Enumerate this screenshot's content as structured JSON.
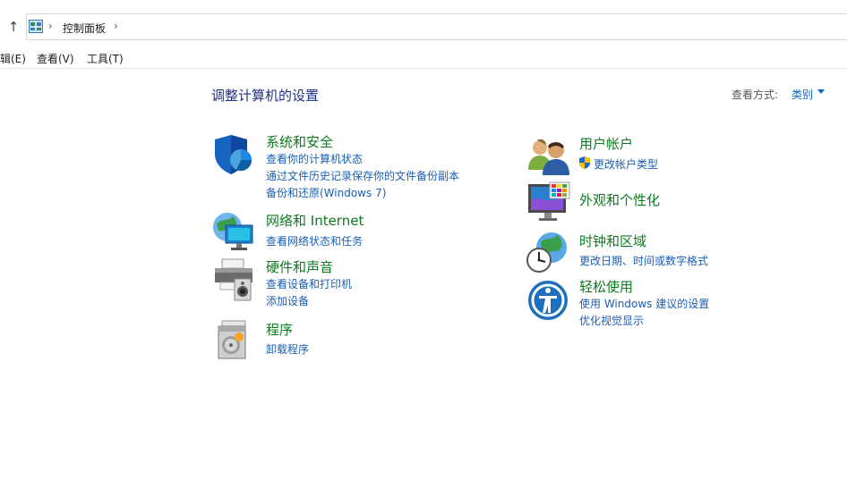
{
  "address": {
    "breadcrumb": "控制面板"
  },
  "menu": {
    "items": [
      "编辑(E)",
      "查看(V)",
      "工具(T)"
    ]
  },
  "main": {
    "title": "调整计算机的设置",
    "view_by_label": "查看方式:",
    "view_by_value": "类别"
  },
  "categories": {
    "security": {
      "title": "系统和安全",
      "links": [
        "查看你的计算机状态",
        "通过文件历史记录保存你的文件备份副本",
        "备份和还原(Windows 7)"
      ]
    },
    "network": {
      "title": "网络和 Internet",
      "links": [
        "查看网络状态和任务"
      ]
    },
    "hardware": {
      "title": "硬件和声音",
      "links": [
        "查看设备和打印机",
        "添加设备"
      ]
    },
    "programs": {
      "title": "程序",
      "links": [
        "卸载程序"
      ]
    },
    "users": {
      "title": "用户帐户",
      "links": [
        "更改帐户类型"
      ]
    },
    "appearance": {
      "title": "外观和个性化",
      "links": []
    },
    "clock": {
      "title": "时钟和区域",
      "links": [
        "更改日期、时间或数字格式"
      ]
    },
    "ease": {
      "title": "轻松使用",
      "links": [
        "使用 Windows 建议的设置",
        "优化视觉显示"
      ]
    }
  },
  "colors": {
    "title_blue": "#1e3287",
    "category_green": "#0d7a1f",
    "link_blue": "#1a5fb4"
  }
}
